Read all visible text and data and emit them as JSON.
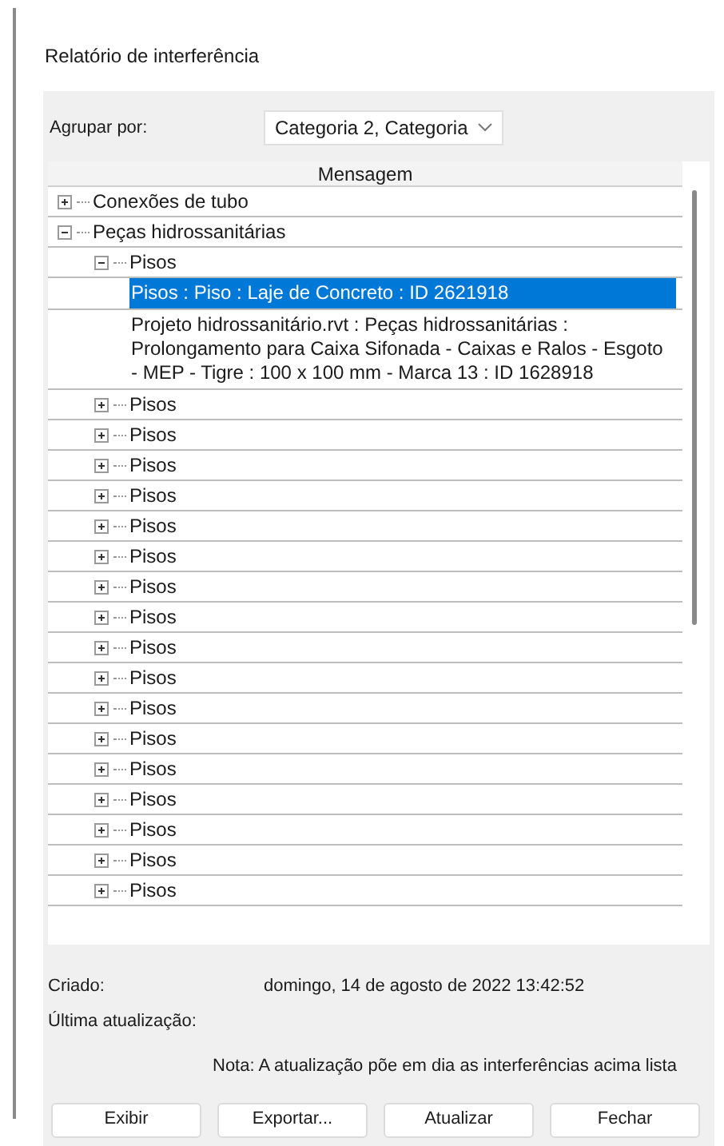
{
  "window": {
    "title": "Relatório de interferência"
  },
  "group_by": {
    "label": "Agrupar por:",
    "value": "Categoria 2, Categoria"
  },
  "tree": {
    "column": "Mensagem",
    "items": [
      {
        "label": "Conexões de tubo",
        "expanded": false
      },
      {
        "label": "Peças hidrossanitárias",
        "expanded": true,
        "children": [
          {
            "label": "Pisos",
            "expanded": true,
            "children": [
              {
                "label": "Pisos : Piso : Laje de Concreto : ID 2621918",
                "selected": true
              },
              {
                "label": "Projeto hidrossanitário.rvt : Peças hidrossanitárias : Prolongamento para Caixa Sifonada - Caixas e Ralos - Esgoto - MEP - Tigre : 100 x 100 mm - Marca 13 : ID 1628918",
                "selected": false
              }
            ]
          },
          {
            "label": "Pisos",
            "expanded": false
          },
          {
            "label": "Pisos",
            "expanded": false
          },
          {
            "label": "Pisos",
            "expanded": false
          },
          {
            "label": "Pisos",
            "expanded": false
          },
          {
            "label": "Pisos",
            "expanded": false
          },
          {
            "label": "Pisos",
            "expanded": false
          },
          {
            "label": "Pisos",
            "expanded": false
          },
          {
            "label": "Pisos",
            "expanded": false
          },
          {
            "label": "Pisos",
            "expanded": false
          },
          {
            "label": "Pisos",
            "expanded": false
          },
          {
            "label": "Pisos",
            "expanded": false
          },
          {
            "label": "Pisos",
            "expanded": false
          },
          {
            "label": "Pisos",
            "expanded": false
          },
          {
            "label": "Pisos",
            "expanded": false
          },
          {
            "label": "Pisos",
            "expanded": false
          },
          {
            "label": "Pisos",
            "expanded": false
          },
          {
            "label": "Pisos",
            "expanded": false
          }
        ]
      }
    ]
  },
  "created": {
    "label": "Criado:",
    "value": "domingo, 14 de agosto de 2022 13:42:52"
  },
  "last_update": {
    "label": "Última atualização:"
  },
  "note": "Nota: A atualização põe em dia as interferências acima lista",
  "buttons": [
    "Exibir",
    "Exportar...",
    "Atualizar",
    "Fechar"
  ]
}
